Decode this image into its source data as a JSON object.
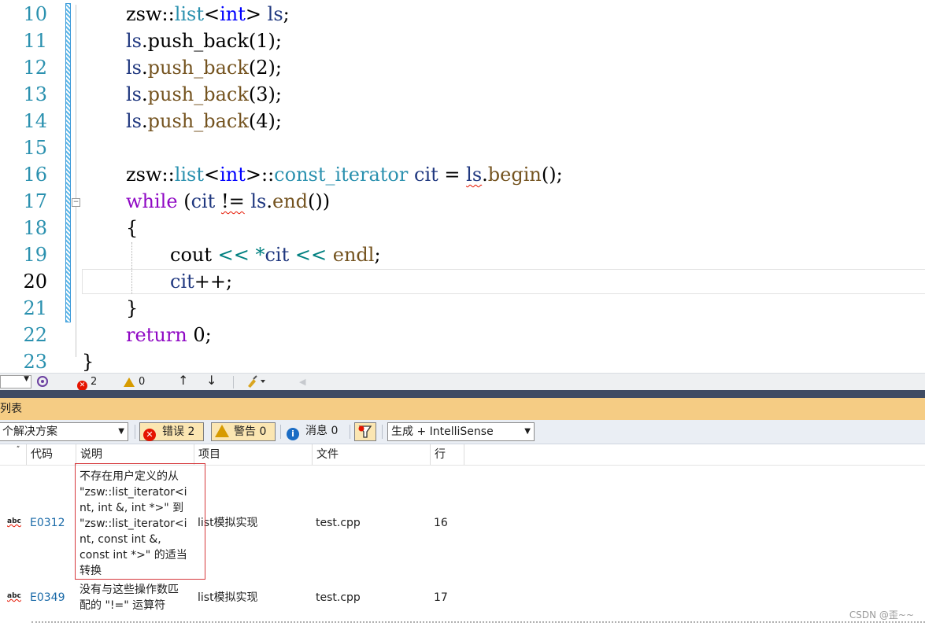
{
  "editor": {
    "line_numbers": [
      "10",
      "11",
      "12",
      "13",
      "14",
      "15",
      "16",
      "17",
      "18",
      "19",
      "20",
      "21",
      "22",
      "23"
    ],
    "current_line": "20",
    "code": {
      "l10": {
        "a": "zsw::",
        "b": "list",
        "c": "<",
        "d": "int",
        "e": "> ",
        "f": "ls",
        "g": ";"
      },
      "l11": {
        "a": "ls",
        "b": ".push_back(1);"
      },
      "l12": {
        "a": "ls",
        "b": ".",
        "c": "push_back",
        "d": "(2);"
      },
      "l13": {
        "a": "ls",
        "b": ".",
        "c": "push_back",
        "d": "(3);"
      },
      "l14": {
        "a": "ls",
        "b": ".",
        "c": "push_back",
        "d": "(4);"
      },
      "l16": {
        "a": "zsw::",
        "b": "list",
        "c": "<",
        "d": "int",
        "e": ">::",
        "f": "const_iterator",
        "g": " ",
        "h": "cit",
        "i": " = ",
        "j": "ls",
        "k": ".",
        "l": "begin",
        "m": "();"
      },
      "l17": {
        "a": "while",
        "b": " (",
        "c": "cit",
        "d": " ",
        "e": "!=",
        "f": " ",
        "g": "ls",
        "h": ".",
        "i": "end",
        "j": "())"
      },
      "l18": "{",
      "l19": {
        "a": "cout",
        "b": " << ",
        "c": "*",
        "d": "cit",
        "e": " << ",
        "f": "endl",
        "g": ";"
      },
      "l20": {
        "a": "cit",
        "b": "++;"
      },
      "l21": "}",
      "l22": {
        "a": "return",
        "b": " 0;"
      },
      "l23": "}"
    }
  },
  "status_strip": {
    "errors": "2",
    "warnings": "0",
    "up_arrow": "↑",
    "down_arrow": "↓",
    "left_arrow": "◀"
  },
  "panel": {
    "title": "列表",
    "scope_combo": "个解决方案",
    "errors_button": "错误 2",
    "warnings_button": "警告 0",
    "messages_button": "消息 0",
    "build_combo": "生成 + IntelliSense"
  },
  "grid": {
    "headers": {
      "code": "代码",
      "desc": "说明",
      "project": "项目",
      "file": "文件",
      "line": "行"
    },
    "rows": [
      {
        "code": "E0312",
        "desc": [
          "不存在用户定义的从",
          "\"zsw::list_iterator<i",
          "nt, int &, int *>\" 到",
          "\"zsw::list_iterator<i",
          "nt, const int &,",
          "const int *>\" 的适当",
          "转换"
        ],
        "project": "list模拟实现",
        "file": "test.cpp",
        "line": "16"
      },
      {
        "code": "E0349",
        "desc": [
          "没有与这些操作数匹",
          "配的 \"!=\" 运算符"
        ],
        "project": "list模拟实现",
        "file": "test.cpp",
        "line": "17"
      }
    ],
    "abc_label": "abc"
  },
  "watermark": "CSDN @歪~~",
  "colors": {
    "keyword": "#0000ff",
    "type": "#2b91af",
    "function": "#74531f",
    "control": "#8f08c4",
    "error": "#e51400",
    "panel_title": "#f5cc84"
  }
}
